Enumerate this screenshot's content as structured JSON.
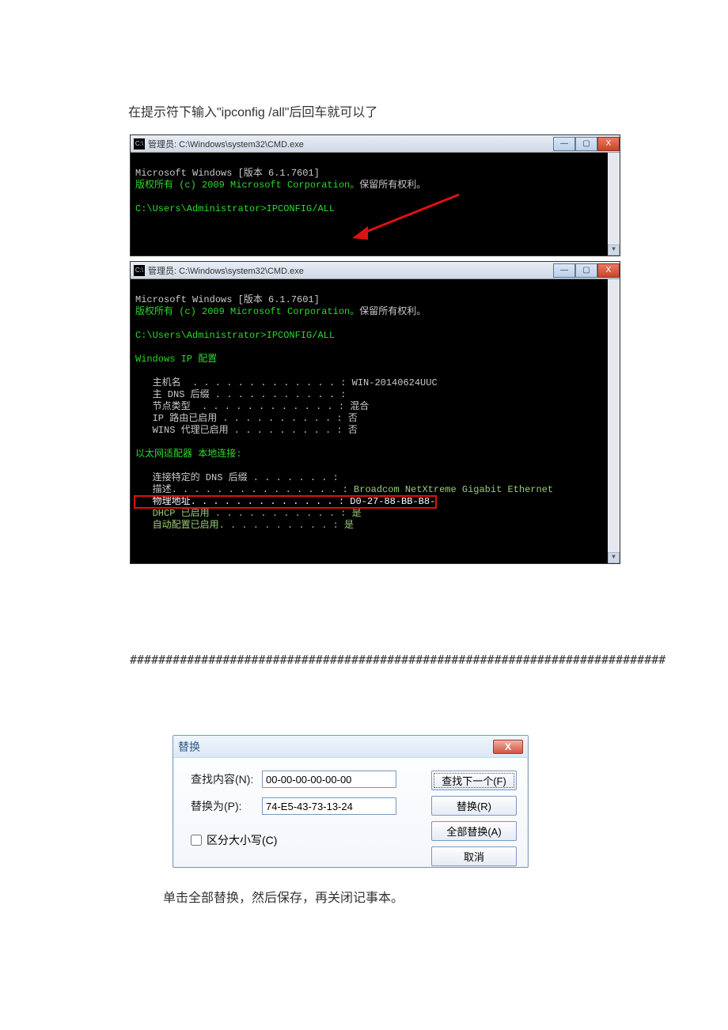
{
  "instruction_top": "在提示符下输入\"ipconfig /all\"后回车就可以了",
  "cmd1": {
    "title": "管理员: C:\\Windows\\system32\\CMD.exe",
    "icon_label": "C:\\",
    "line1": "Microsoft Windows [版本 6.1.7601]",
    "line2_a": "版权所有 (c) 2009 Microsoft Corporation。",
    "line2_b": "保留所有权利。",
    "line3": "C:\\Users\\Administrator>IPCONFIG/ALL"
  },
  "cmd2": {
    "title": "管理员: C:\\Windows\\system32\\CMD.exe",
    "icon_label": "C:\\",
    "l1": "Microsoft Windows [版本 6.1.7601]",
    "l2a": "版权所有 (c) 2009 Microsoft Corporation。",
    "l2b": "保留所有权利。",
    "l3": "C:\\Users\\Administrator>IPCONFIG/ALL",
    "l4": "Windows IP 配置",
    "host_label": "   主机名  . . . . . . . . . . . . . : ",
    "host_val": "WIN-20140624UUC",
    "dns_suffix": "   主 DNS 后缀 . . . . . . . . . . . :",
    "node_type": "   节点类型  . . . . . . . . . . . . : 混合",
    "ip_route": "   IP 路由已启用 . . . . . . . . . . : 否",
    "wins_proxy": "   WINS 代理已启用 . . . . . . . . . : 否",
    "adapter_header": "以太网适配器 本地连接:",
    "conn_dns_suffix": "   连接特定的 DNS 后缀 . . . . . . . :",
    "desc_label": "   描述. . . . . . . . . . . . . . . : ",
    "desc_val": "Broadcom NetXtreme Gigabit Ethernet",
    "phys_label": "   物理地址. . . . . . . . . . . . . : ",
    "phys_val": "D0-27-88-BB-B8-",
    "dhcp_enabled": "   DHCP 已启用 . . . . . . . . . . . : 是",
    "autoconf": "   自动配置已启用. . . . . . . . . . : 是"
  },
  "buttons": {
    "min": "—",
    "max": "▢",
    "close": "X"
  },
  "hash_separator": "###########################################################################",
  "replace_dialog": {
    "title": "替换",
    "find_label": "查找内容(N):",
    "find_value": "00-00-00-00-00-00",
    "replace_label": "替换为(P):",
    "replace_value": "74-E5-43-73-13-24",
    "find_next_btn": "查找下一个(F)",
    "replace_btn": "替换(R)",
    "replace_all_btn": "全部替换(A)",
    "cancel_btn": "取消",
    "match_case_label": "区分大小写(C)"
  },
  "post_instruction": "单击全部替换，然后保存，再关闭记事本。"
}
